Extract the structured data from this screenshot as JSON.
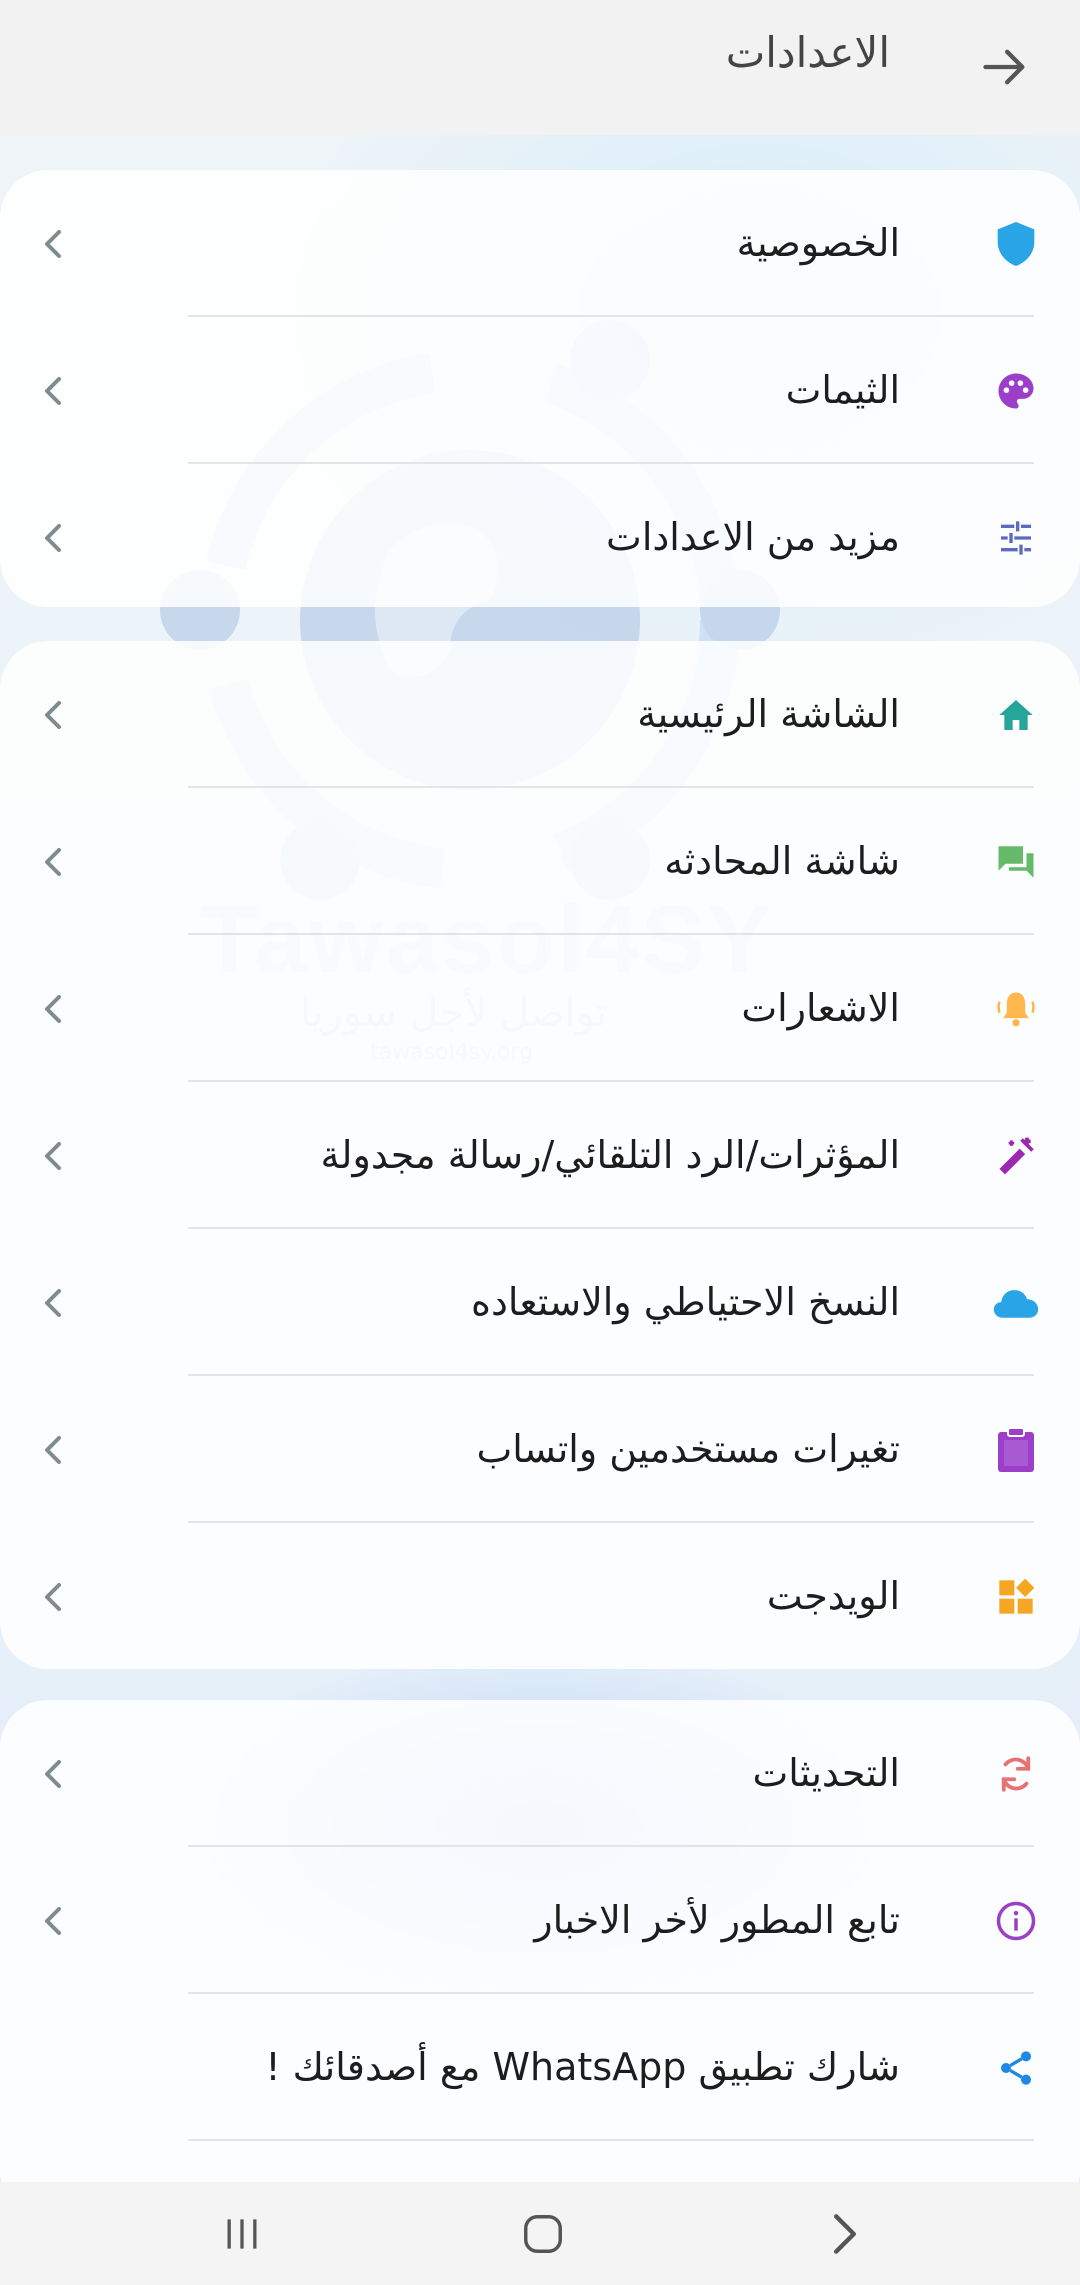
{
  "header": {
    "title": "الاعدادات",
    "back_icon": "arrow-right-icon"
  },
  "sections": [
    {
      "items": [
        {
          "label": "الخصوصية",
          "icon": "shield-icon",
          "color": "#29a4e6"
        },
        {
          "label": "الثيمات",
          "icon": "palette-icon",
          "color": "#9b3fc9"
        },
        {
          "label": "مزيد من الاعدادات",
          "icon": "sliders-icon",
          "color": "#5c6bc0"
        }
      ]
    },
    {
      "items": [
        {
          "label": "الشاشة الرئيسية",
          "icon": "home-icon",
          "color": "#26a69a"
        },
        {
          "label": "شاشة المحادثه",
          "icon": "chat-icon",
          "color": "#66bb6a"
        },
        {
          "label": "الاشعارات",
          "icon": "bell-icon",
          "color": "#ffb74d"
        },
        {
          "label": "المؤثرات/الرد التلقائي/رسالة مجدولة",
          "icon": "magic-wand-icon",
          "color": "#9c27b0"
        },
        {
          "label": "النسخ الاحتياطي والاستعاده",
          "icon": "cloud-icon",
          "color": "#29a4e6"
        },
        {
          "label": "تغيرات مستخدمين واتساب",
          "icon": "clipboard-icon",
          "color": "#9b3fc9"
        },
        {
          "label": "الويدجت",
          "icon": "widget-icon",
          "color": "#f5a623"
        }
      ]
    },
    {
      "items": [
        {
          "label": "التحديثات",
          "icon": "refresh-icon",
          "color": "#e57373"
        },
        {
          "label": "تابع المطور لأخر الاخبار",
          "icon": "info-icon",
          "color": "#9b3fc9"
        },
        {
          "label": "شارك تطبيق WhatsApp مع أصدقائك !",
          "icon": "share-icon",
          "color": "#1e88e5"
        }
      ]
    }
  ],
  "watermark": {
    "brand": "Tawasol4SY",
    "tagline": "تواصل لأجل سوريا",
    "url": "tawasol4sy.org"
  },
  "navbar": {
    "recent_icon": "recent-apps-icon",
    "home_icon": "home-button-icon",
    "back_icon": "nav-back-icon"
  }
}
